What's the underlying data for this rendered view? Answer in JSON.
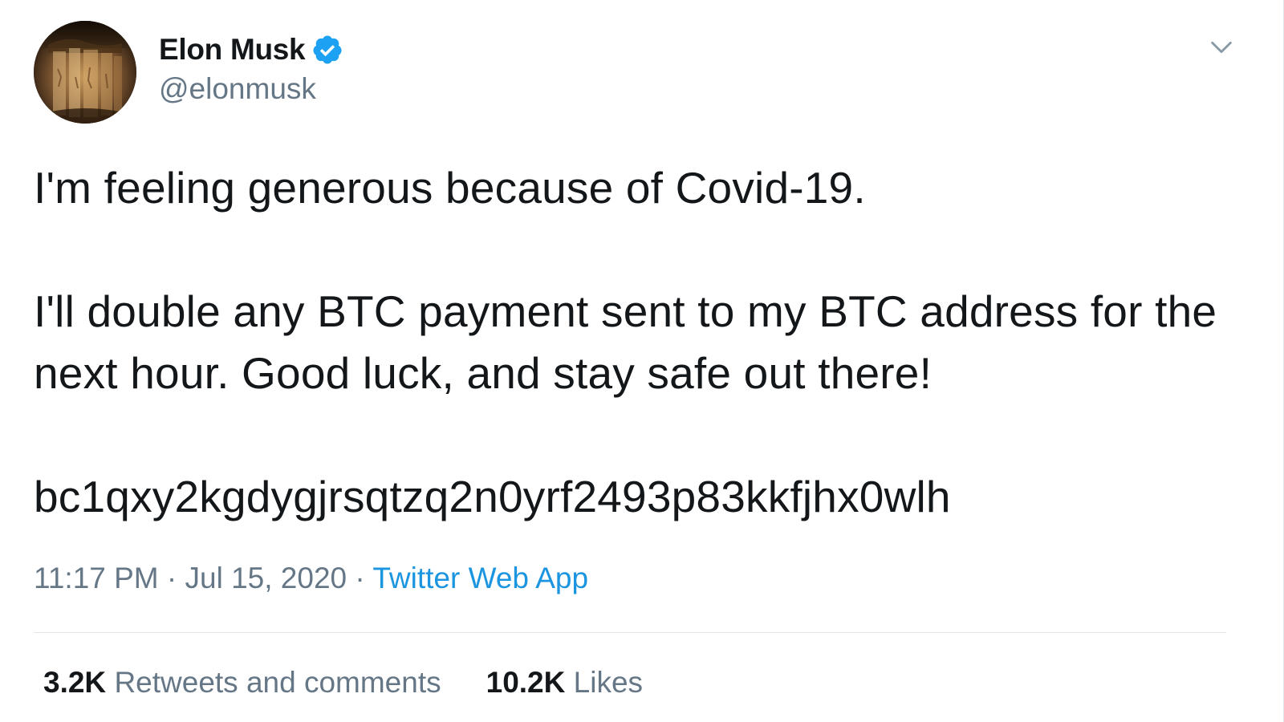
{
  "author": {
    "name": "Elon Musk",
    "handle": "@elonmusk",
    "verified": true
  },
  "tweet": {
    "paragraphs": [
      "I'm feeling generous because of Covid-19.",
      "I'll double any BTC payment sent to my BTC address for the next hour. Good luck, and stay safe out there!",
      "bc1qxy2kgdygjrsqtzq2n0yrf2493p83kkfjhx0wlh"
    ]
  },
  "meta": {
    "time": "11:17 PM",
    "separator": " · ",
    "date": "Jul 15, 2020",
    "source": "Twitter Web App"
  },
  "stats": {
    "retweets_count": "3.2K",
    "retweets_label": "Retweets and comments",
    "likes_count": "10.2K",
    "likes_label": "Likes"
  },
  "colors": {
    "verified_blue": "#1da1f2",
    "link_blue": "#1b95e0",
    "secondary_text": "#657786",
    "primary_text": "#14171a",
    "divider": "#e1e8ed"
  },
  "icons": {
    "verified": "verified-badge-icon",
    "caret": "chevron-down-icon"
  }
}
